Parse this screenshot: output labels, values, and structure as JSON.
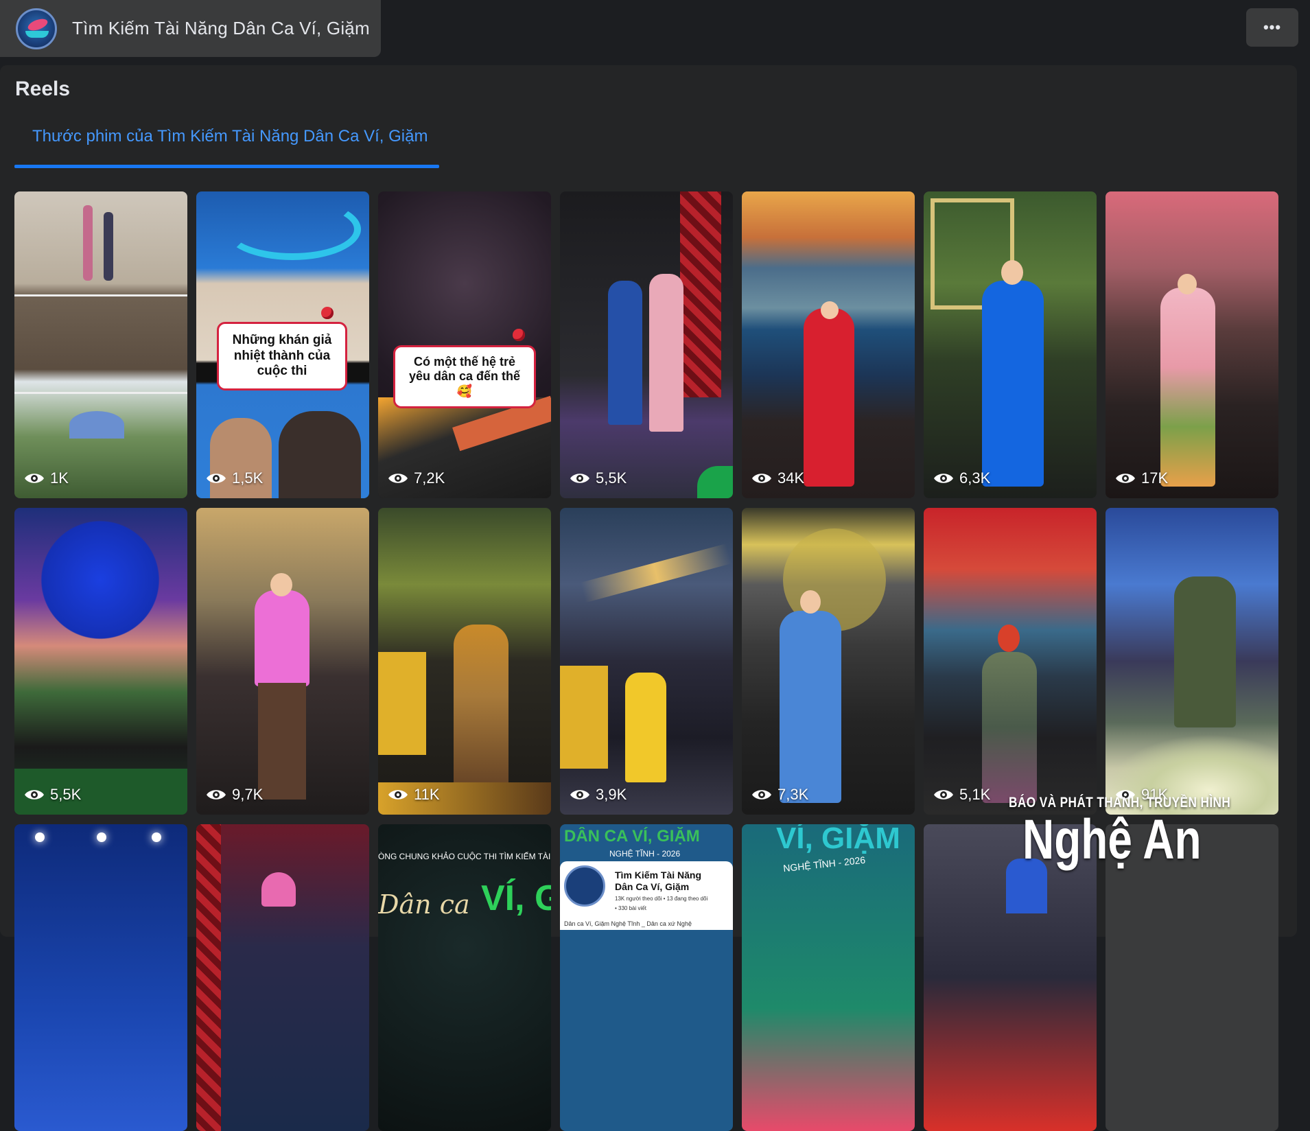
{
  "header": {
    "page_name": "Tìm Kiếm Tài Năng Dân Ca Ví, Giặm",
    "more_label": "•••"
  },
  "section": {
    "title": "Reels",
    "tab_label": "Thước phim của Tìm Kiếm Tài Năng Dân Ca Ví, Giặm"
  },
  "reels": [
    {
      "views": "1K"
    },
    {
      "views": "1,5K",
      "caption": "Những khán giả nhiệt thành của cuộc thi"
    },
    {
      "views": "7,2K",
      "caption": "Có một thế hệ trẻ yêu dân ca đến thế 🥰"
    },
    {
      "views": "5,5K"
    },
    {
      "views": "34K"
    },
    {
      "views": "6,3K"
    },
    {
      "views": "17K"
    },
    {
      "views": "5,5K"
    },
    {
      "views": "9,7K"
    },
    {
      "views": "11K"
    },
    {
      "views": "3,9K"
    },
    {
      "views": "7,3K"
    },
    {
      "views": "5,1K"
    },
    {
      "views": "91K"
    },
    {
      "views": ""
    },
    {
      "views": ""
    },
    {
      "views": "",
      "overlay_text_1": "ÒNG CHUNG KHẢO CUỘC THI TÌM KIẾM TÀI",
      "overlay_text_2": "Dân ca",
      "overlay_text_3": "VÍ, GI"
    },
    {
      "views": "",
      "profile": {
        "banner": "DÂN CA VÍ, GIẶM",
        "subbanner": "NGHỆ TĨNH - 2026",
        "name_line1": "Tìm Kiếm Tài Năng",
        "name_line2": "Dân Ca Ví, Giặm",
        "stats": "13K người theo dõi • 13 đang theo dõi",
        "posts": "• 330 bài viết",
        "footer": "Dân ca Ví, Giặm Nghệ Tĩnh _ Dân ca xứ Nghệ"
      }
    },
    {
      "views": "",
      "overlay_text_1": "VÍ, GIẶM",
      "overlay_text_2": "NGHỆ TĨNH - 2026"
    },
    {
      "views": ""
    },
    {
      "views": ""
    }
  ],
  "watermark": {
    "line1": "BÁO VÀ PHÁT THANH, TRUYỀN HÌNH",
    "line2": "Nghệ An"
  }
}
